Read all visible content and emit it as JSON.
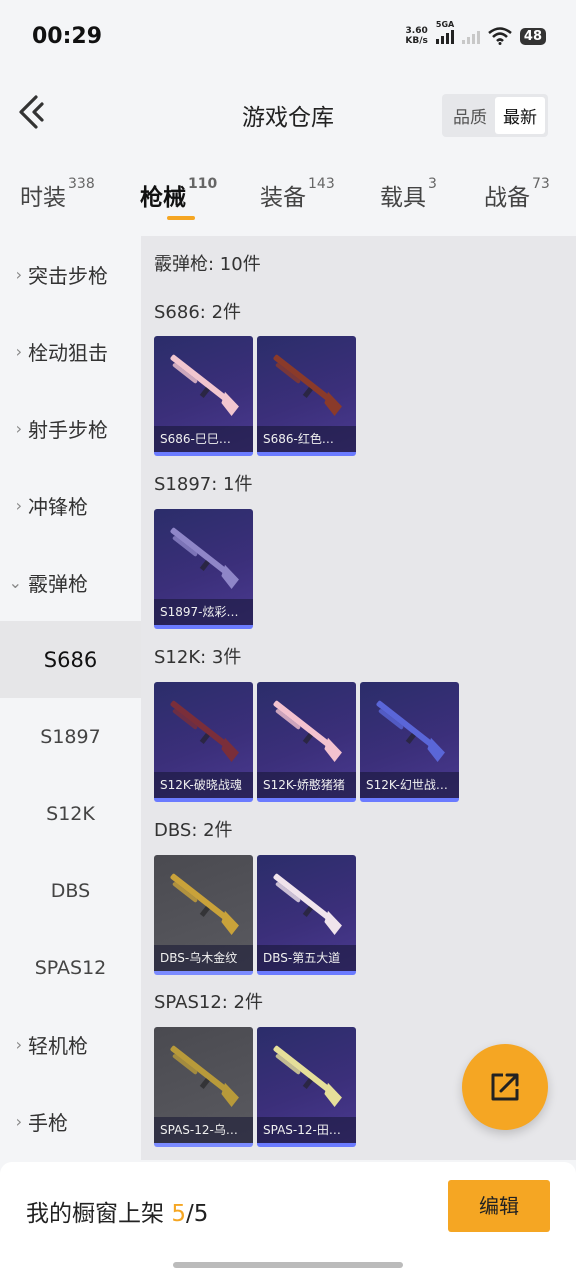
{
  "status": {
    "time": "00:29",
    "net_speed_value": "3.60",
    "net_speed_unit": "KB/s",
    "network_type": "5GA",
    "battery": "48"
  },
  "header": {
    "title": "游戏仓库",
    "sort_options": [
      "品质",
      "最新"
    ],
    "sort_selected": "最新"
  },
  "category_tabs": [
    {
      "label": "时装",
      "count": "338"
    },
    {
      "label": "枪械",
      "count": "110"
    },
    {
      "label": "装备",
      "count": "143"
    },
    {
      "label": "载具",
      "count": "3"
    },
    {
      "label": "战备",
      "count": "73"
    }
  ],
  "active_tab": "枪械",
  "sidebar": {
    "categories": [
      "突击步枪",
      "栓动狙击",
      "射手步枪",
      "冲锋枪",
      "霰弹枪",
      "轻机枪",
      "手枪"
    ],
    "expanded": "霰弹枪",
    "subcategories": [
      "S686",
      "S1897",
      "S12K",
      "DBS",
      "SPAS12"
    ],
    "selected_sub": "S686"
  },
  "content": {
    "summary": "霰弹枪: 10件",
    "sections": [
      {
        "title": "S686: 2件",
        "items": [
          {
            "name": "S686-巳巳…",
            "color_theme": "purple",
            "weapon_color": "#f2c6cf"
          },
          {
            "name": "S686-红色…",
            "color_theme": "purple",
            "weapon_color": "#8a3a2a"
          }
        ]
      },
      {
        "title": "S1897: 1件",
        "items": [
          {
            "name": "S1897-炫彩…",
            "color_theme": "purple",
            "weapon_color": "#8f86c8"
          }
        ]
      },
      {
        "title": "S12K: 3件",
        "items": [
          {
            "name": "S12K-破晓战魂",
            "color_theme": "purple",
            "weapon_color": "#7a2e3a"
          },
          {
            "name": "S12K-娇憨猪猪",
            "color_theme": "purple",
            "weapon_color": "#f3c2cf"
          },
          {
            "name": "S12K-幻世战…",
            "color_theme": "purple",
            "weapon_color": "#5a66d8"
          }
        ]
      },
      {
        "title": "DBS: 2件",
        "items": [
          {
            "name": "DBS-乌木金纹",
            "color_theme": "gray",
            "weapon_color": "#c9a23a"
          },
          {
            "name": "DBS-第五大道",
            "color_theme": "purple",
            "weapon_color": "#f0e4ec"
          }
        ]
      },
      {
        "title": "SPAS12: 2件",
        "items": [
          {
            "name": "SPAS-12-乌…",
            "color_theme": "gray",
            "weapon_color": "#b89a3a"
          },
          {
            "name": "SPAS-12-田…",
            "color_theme": "purple",
            "weapon_color": "#e6df9a"
          }
        ]
      }
    ]
  },
  "bottom_bar": {
    "showcase_label": "我的橱窗上架",
    "showcase_current": "5",
    "showcase_sep": "/",
    "showcase_total": "5",
    "edit_label": "编辑"
  },
  "colors": {
    "accent": "#f5a623",
    "card_purple": "#3b2f7a",
    "card_gray": "#55555b",
    "card_border": "#6b7bff"
  }
}
